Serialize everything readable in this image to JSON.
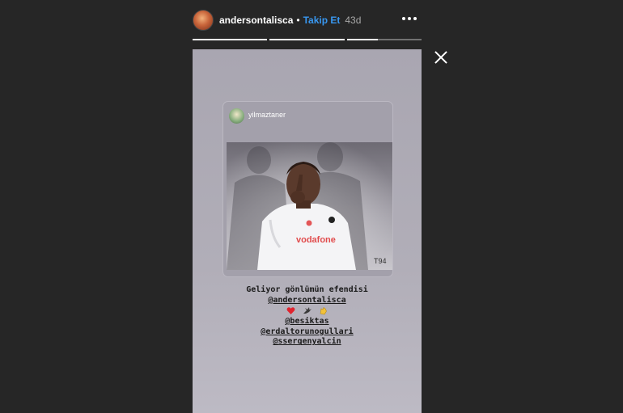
{
  "header": {
    "username": "andersontalisca",
    "separator": "•",
    "follow_label": "Takip Et",
    "time": "43d"
  },
  "progress": {
    "segment_count": 3,
    "fills": [
      1.0,
      1.0,
      0.42
    ]
  },
  "card": {
    "username": "yilmaztaner",
    "watermark": "T94"
  },
  "caption": {
    "line1": "Geliyor gönlümün efendisi",
    "mention1": "@andersontalisca",
    "emoji_line": [
      "heart-emoji",
      "eagle-emoji",
      "clapping-hands-emoji"
    ],
    "mention2": "@besiktas",
    "mention3": "@erdaltorunogullari",
    "mention4": "@ssergenyalcin"
  },
  "colors": {
    "background": "#262626",
    "follow": "#3897f0",
    "story_bg": "#aeabb5",
    "caption_text": "#1a1a1a"
  }
}
